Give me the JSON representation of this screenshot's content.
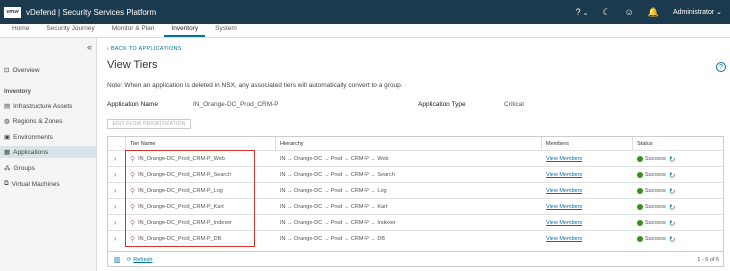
{
  "header": {
    "logo": "vmw",
    "title": "vDefend | Security Services Platform",
    "help": "?",
    "help_caret": "⌄",
    "theme": "☾",
    "face": "☺",
    "bell": "🔔",
    "user": "Administrator",
    "user_caret": "⌄"
  },
  "tabs": [
    "Home",
    "Security Journey",
    "Monitor & Plan",
    "Inventory",
    "System"
  ],
  "sidebar": {
    "collapse": "«",
    "overview": "Overview",
    "section": "Inventory",
    "items": [
      "Infrastructure Assets",
      "Regions & Zones",
      "Environments",
      "Applications",
      "Groups",
      "Virtual Machines"
    ]
  },
  "main": {
    "back": "‹ BACK TO APPLICATIONS",
    "title": "View Tiers",
    "help": "?",
    "note": "Note: When an application is deleted in NSX, any associated tiers will automatically convert to a group.",
    "app_name_label": "Application Name",
    "app_name": "IN_Orange-DC_Prod_CRM-P",
    "app_type_label": "Application Type",
    "app_type": "Critical",
    "edit_button": "EDIT FLOW PRIORITIZATION"
  },
  "grid": {
    "headers": [
      "Tier Name",
      "Hierarchy",
      "Members",
      "Status"
    ],
    "rows": [
      {
        "name": "IN_Orange-DC_Prod_CRM-P_Web",
        "hierarchy": "IN  →  Orange-DC  →  Prod  →  CRM-P  →  Web",
        "members": "View Members",
        "status": "Success"
      },
      {
        "name": "IN_Orange-DC_Prod_CRM-P_Search",
        "hierarchy": "IN  →  Orange-DC  →  Prod  →  CRM-P  →  Search",
        "members": "View Members",
        "status": "Success"
      },
      {
        "name": "IN_Orange-DC_Prod_CRM-P_Log",
        "hierarchy": "IN  →  Orange-DC  →  Prod  →  CRM-P  →  Log",
        "members": "View Members",
        "status": "Success"
      },
      {
        "name": "IN_Orange-DC_Prod_CRM-P_Kart",
        "hierarchy": "IN  →  Orange-DC  →  Prod  →  CRM-P  →  Kart",
        "members": "View Members",
        "status": "Success"
      },
      {
        "name": "IN_Orange-DC_Prod_CRM-P_Indexer",
        "hierarchy": "IN  →  Orange-DC  →  Prod  →  CRM-P  →  Indexer",
        "members": "View Members",
        "status": "Success"
      },
      {
        "name": "IN_Orange-DC_Prod_CRM-P_DB",
        "hierarchy": "IN  →  Orange-DC  →  Prod  →  CRM-P  →  DB",
        "members": "View Members",
        "status": "Success"
      }
    ],
    "footer_refresh": "Refresh",
    "footer_count": "1 - 6 of 6"
  },
  "icons": {
    "chevron": "›",
    "tier": "⚲",
    "refresh": "↻",
    "columns": "▥",
    "refresh_small": "⟳"
  },
  "colors": {
    "header_bg": "#1b3a4d",
    "accent": "#0072a3",
    "success": "#3c8f1f",
    "highlight": "#d9312f"
  }
}
